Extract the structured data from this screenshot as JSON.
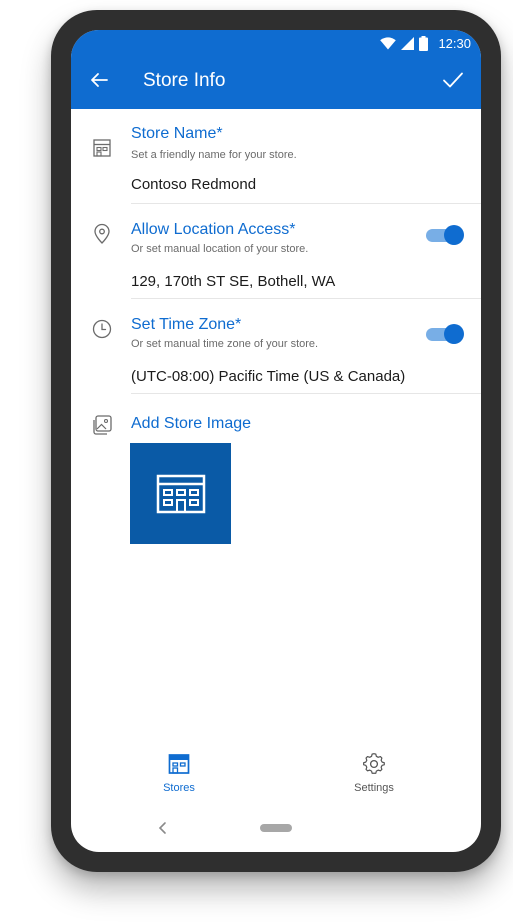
{
  "status_bar": {
    "time": "12:30",
    "icons": [
      "wifi-icon",
      "signal-icon",
      "battery-icon"
    ]
  },
  "app_bar": {
    "title": "Store Info",
    "back_icon": "arrow-left-icon",
    "confirm_icon": "checkmark-icon"
  },
  "sections": [
    {
      "icon": "store-icon",
      "title": "Store Name*",
      "subtitle": "Set a friendly name for your store.",
      "value": "Contoso Redmond"
    },
    {
      "icon": "location-pin-icon",
      "title": "Allow Location Access*",
      "subtitle": "Or set manual location of your store.",
      "value": "129, 170th ST SE, Bothell, WA",
      "toggle_on": true
    },
    {
      "icon": "clock-icon",
      "title": "Set Time Zone*",
      "subtitle": "Or set manual time zone of your store.",
      "value": "(UTC-08:00) Pacific Time (US & Canada)",
      "toggle_on": true
    },
    {
      "icon": "image-gallery-icon",
      "title": "Add Store Image"
    }
  ],
  "bottom_nav": {
    "items": [
      {
        "label": "Stores",
        "icon": "store-icon",
        "active": true
      },
      {
        "label": "Settings",
        "icon": "gear-icon",
        "active": false
      }
    ]
  },
  "colors": {
    "accent": "#0f6cd0",
    "store_image_bg": "#0a5aa6",
    "toggle_track": "#78aee6",
    "muted_text": "#6b6b6b",
    "inactive_nav": "#555555"
  }
}
